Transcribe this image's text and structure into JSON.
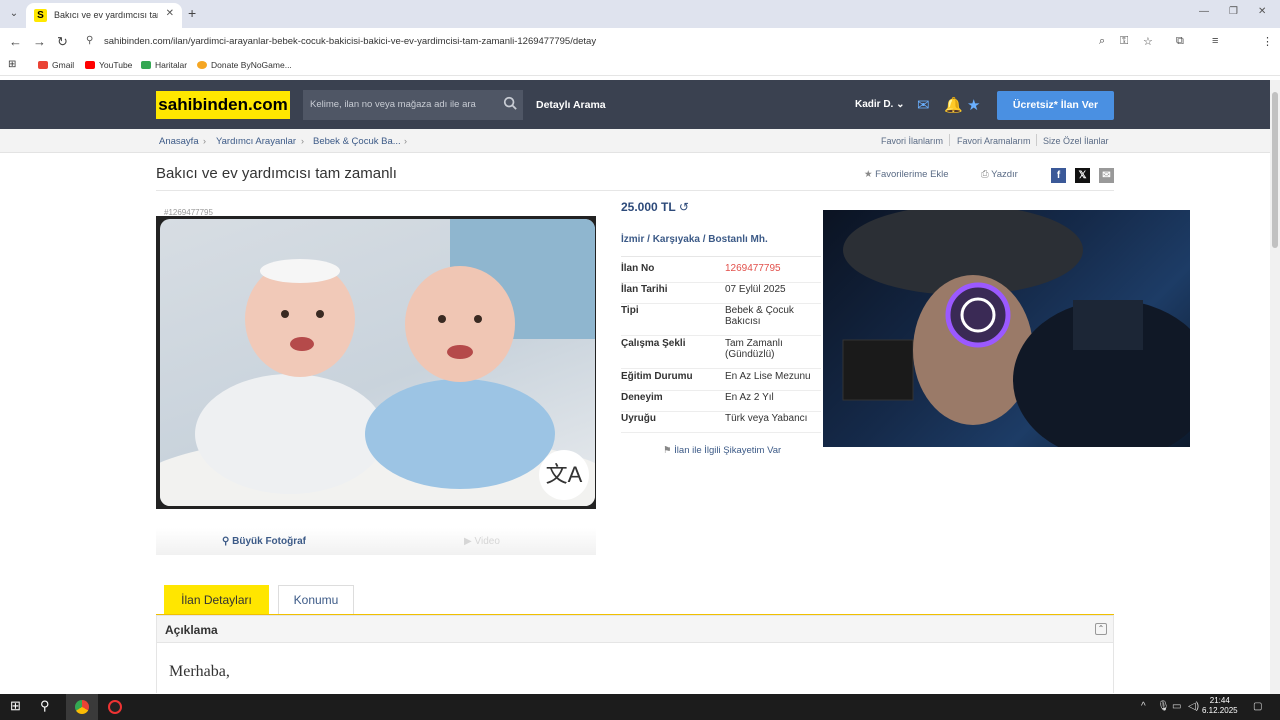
{
  "browser": {
    "tab_title": "Bakıcı ve ev yardımcısı tam zam",
    "tab_favicon": "S",
    "url": "sahibinden.com/ilan/yardimci-arayanlar-bebek-cocuk-bakicisi-bakici-ve-ev-yardimcisi-tam-zamanli-1269477795/detay",
    "bookmarks": [
      "Gmail",
      "YouTube",
      "Haritalar",
      "Donate ByNoGame..."
    ]
  },
  "header": {
    "logo": "sahibinden.com",
    "search_placeholder": "Kelime, ilan no veya mağaza adı ile ara",
    "advanced_search": "Detaylı Arama",
    "user": "Kadir D.",
    "post_button": "Ücretsiz* İlan Ver"
  },
  "breadcrumb": [
    "Anasayfa",
    "Yardımcı Arayanlar",
    "Bebek & Çocuk Ba..."
  ],
  "header_links": [
    "Favori İlanlarım",
    "Favori Aramalarım",
    "Size Özel İlanlar"
  ],
  "listing": {
    "title": "Bakıcı ve ev yardımcısı tam zamanlı",
    "add_favorites": "Favorilerime Ekle",
    "print": "Yazdır",
    "listing_no_small": "#1269477795",
    "big_photo": "Büyük Fotoğraf",
    "video": "Video",
    "price": "25.000 TL",
    "location": {
      "city": "İzmir",
      "district": "Karşıyaka",
      "neighborhood": "Bostanlı Mh."
    },
    "details": [
      {
        "key": "İlan No",
        "value": "1269477795"
      },
      {
        "key": "İlan Tarihi",
        "value": "07 Eylül 2025"
      },
      {
        "key": "Tipi",
        "value": "Bebek & Çocuk Bakıcısı"
      },
      {
        "key": "Çalışma Şekli",
        "value": "Tam Zamanlı (Gündüzlü)"
      },
      {
        "key": "Eğitim Durumu",
        "value": "En Az Lise Mezunu"
      },
      {
        "key": "Deneyim",
        "value": "En Az 2 Yıl"
      },
      {
        "key": "Uyruğu",
        "value": "Türk veya Yabancı"
      }
    ],
    "complaint": "İlan ile İlgili Şikayetim Var"
  },
  "tabs": {
    "details": "İlan Detayları",
    "location": "Konumu"
  },
  "description": {
    "title": "Açıklama",
    "greeting": "Merhaba,"
  },
  "taskbar": {
    "time": "21:44",
    "date": "6.12.2025"
  },
  "colors": {
    "brand_yellow": "#ffe800",
    "header_bg": "#3a4150",
    "post_button": "#4a90e2",
    "listing_no": "#e2504b"
  }
}
